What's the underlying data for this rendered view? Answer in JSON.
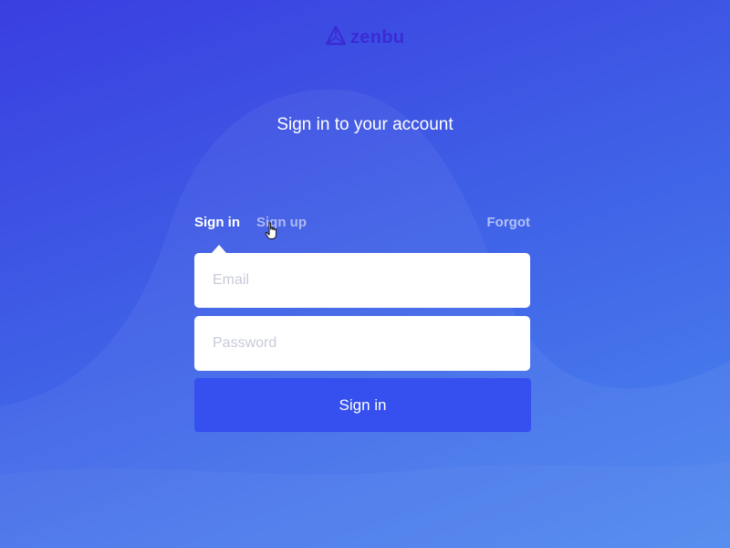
{
  "brand": {
    "name": "zenbu",
    "logo_icon": "triangle-logo-icon",
    "logo_color": "#3a2bd6"
  },
  "heading": "Sign in to your account",
  "tabs": [
    {
      "label": "Sign in",
      "active": true
    },
    {
      "label": "Sign up",
      "active": false
    }
  ],
  "forgot_label": "Forgot",
  "form": {
    "email": {
      "value": "",
      "placeholder": "Email"
    },
    "password": {
      "value": "",
      "placeholder": "Password"
    },
    "submit_label": "Sign in"
  },
  "colors": {
    "background_start": "#3a3ee0",
    "background_end": "#4a86ef",
    "button": "#3550ef",
    "text": "#ffffff"
  },
  "cursor_icon": "hand-pointer-icon"
}
